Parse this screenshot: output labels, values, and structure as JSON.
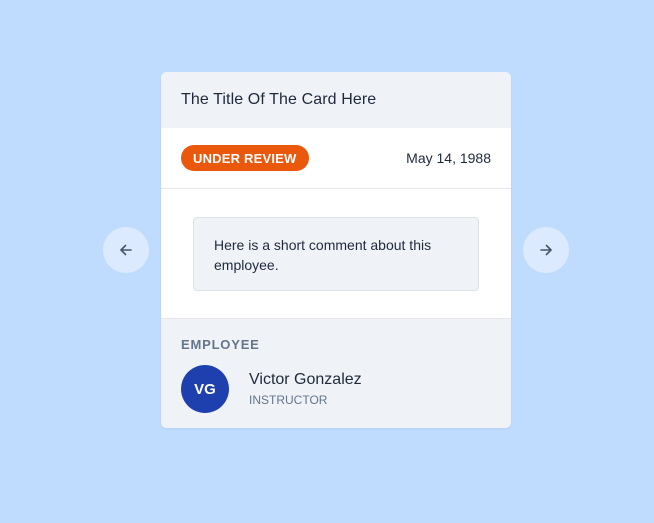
{
  "nav": {
    "prev_icon": "arrow-left-icon",
    "next_icon": "arrow-right-icon"
  },
  "card": {
    "title": "The Title Of The Card Here",
    "status": "UNDER REVIEW",
    "date": "May 14, 1988",
    "comment": "Here is a short comment about this employee.",
    "employee_heading": "EMPLOYEE",
    "employee": {
      "initials": "VG",
      "name": "Victor Gonzalez",
      "role": "INSTRUCTOR"
    }
  },
  "colors": {
    "background": "#bfdbfe",
    "nav_button": "#dbeafe",
    "badge": "#ea580c",
    "avatar": "#1e40af",
    "panel": "#eff3f8"
  }
}
